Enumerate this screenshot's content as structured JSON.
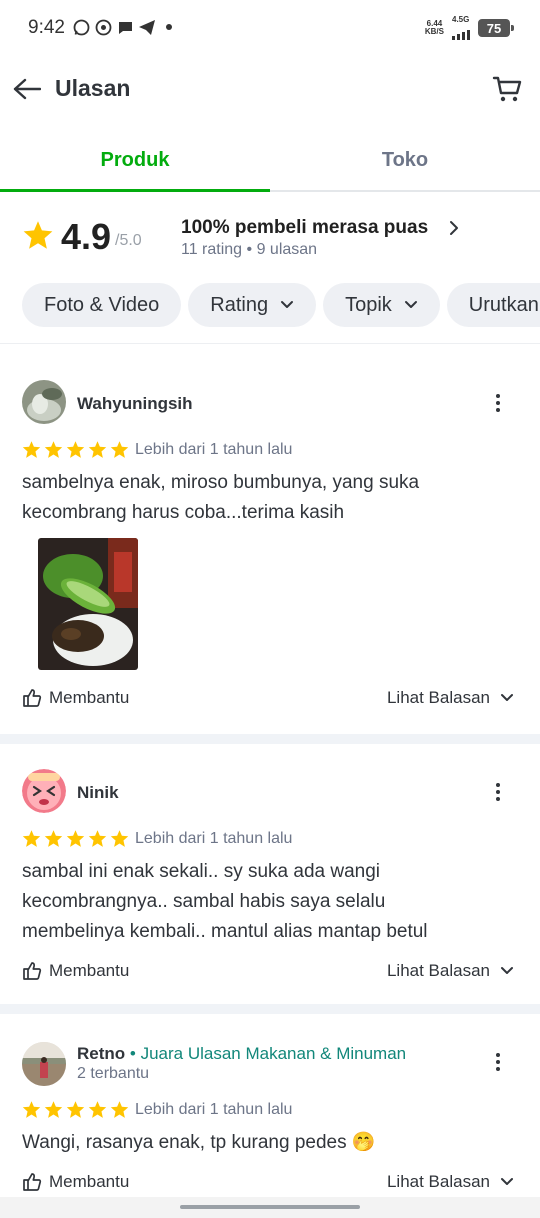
{
  "status_bar": {
    "time": "9:42",
    "net_speed_value": "6.44",
    "net_speed_unit": "KB/S",
    "network": "4.5G",
    "battery": "75"
  },
  "header": {
    "title": "Ulasan"
  },
  "tabs": [
    {
      "label": "Produk",
      "active": true
    },
    {
      "label": "Toko",
      "active": false
    }
  ],
  "summary": {
    "rating": "4.9",
    "max": "/5.0",
    "satisfied_text": "100% pembeli merasa puas",
    "counts_text": "11 rating • 9 ulasan"
  },
  "filters": [
    {
      "label": "Foto & Video",
      "has_dropdown": false
    },
    {
      "label": "Rating",
      "has_dropdown": true
    },
    {
      "label": "Topik",
      "has_dropdown": true
    },
    {
      "label": "Urutkan",
      "has_dropdown": true
    }
  ],
  "reviews": [
    {
      "name": "Wahyuningsih",
      "badge": "",
      "sub": "",
      "stars": 5,
      "time": "Lebih dari 1 tahun lalu",
      "text_lines": [
        "sambelnya enak, miroso bumbunya, yang suka",
        "kecombrang harus coba...terima kasih"
      ],
      "has_photo": true,
      "helpful_label": "Membantu",
      "replies_label": "Lihat Balasan"
    },
    {
      "name": "Ninik",
      "badge": "",
      "sub": "",
      "stars": 5,
      "time": "Lebih dari 1 tahun lalu",
      "text_lines": [
        "sambal ini enak sekali.. sy suka ada wangi",
        "kecombrangnya.. sambal habis saya selalu",
        "membelinya kembali.. mantul alias mantap betul"
      ],
      "has_photo": false,
      "helpful_label": "Membantu",
      "replies_label": "Lihat Balasan"
    },
    {
      "name": "Retno",
      "badge": "• Juara Ulasan Makanan & Minuman",
      "sub": "2 terbantu",
      "stars": 5,
      "time": "Lebih dari 1 tahun lalu",
      "text_lines": [
        "Wangi, rasanya enak, tp kurang pedes 🤭"
      ],
      "has_photo": false,
      "helpful_label": "Membantu",
      "replies_label": "Lihat Balasan"
    }
  ],
  "colors": {
    "accent": "#03ac0e",
    "star": "#ffc400",
    "badge": "#12877a"
  }
}
